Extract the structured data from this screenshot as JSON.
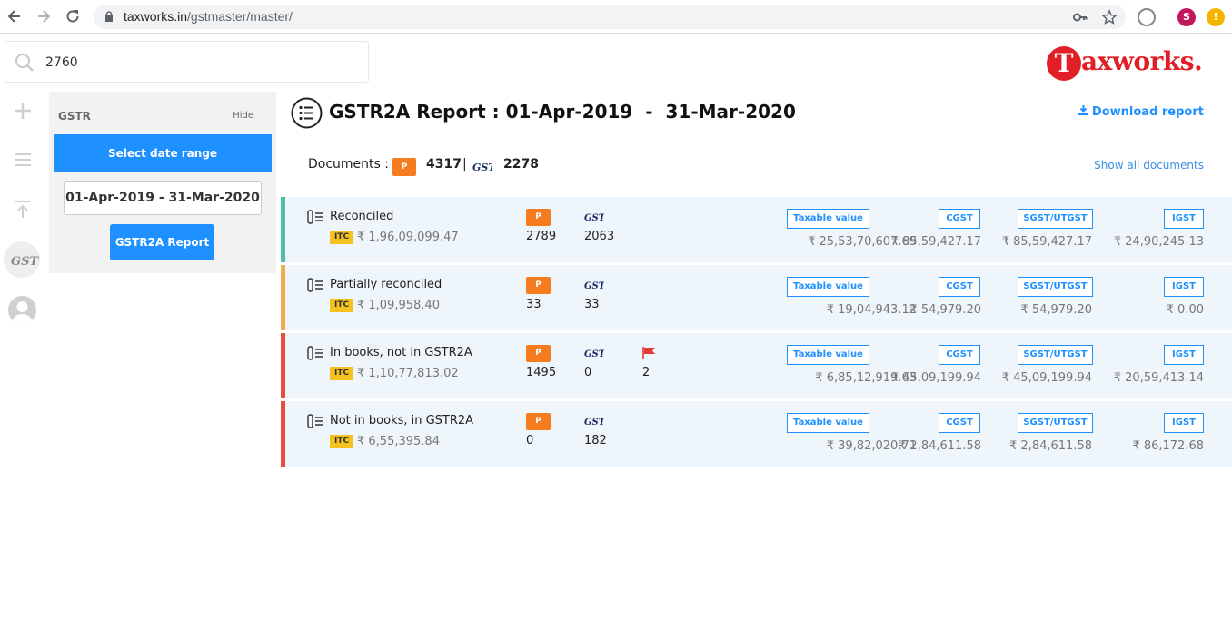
{
  "browser": {
    "url_host": "taxworks.in",
    "url_path": "/gstmaster/master/",
    "profile_initial": "S",
    "alert_symbol": "!"
  },
  "search": {
    "value": "2760"
  },
  "logo": {
    "first_letter": "T",
    "rest": "axworks."
  },
  "sidebar": {
    "title": "GSTR",
    "hide_label": "Hide",
    "select_label": "Select date range",
    "date_range": "01-Apr-2019 - 31-Mar-2020",
    "report_button": "GSTR2A Report"
  },
  "main": {
    "title": "GSTR2A Report : 01-Apr-2019  -  31-Mar-2020",
    "download_label": "Download report",
    "show_all": "Show all documents",
    "documents": {
      "label": "Documents :",
      "p_badge": "P",
      "p_count": "4317",
      "separator": "|",
      "gst_count": "2278"
    }
  },
  "columns": {
    "taxable": "Taxable value",
    "cgst": "CGST",
    "sgst": "SGST/UTGST",
    "igst": "IGST"
  },
  "rows": [
    {
      "label": "Reconciled",
      "itc": "ITC",
      "itc_value": "₹ 1,96,09,099.47",
      "p_badge": "P",
      "p_count": "2789",
      "gst_count": "2063",
      "flag_count": "",
      "taxable": "₹ 25,53,70,607.69",
      "cgst": "₹ 85,59,427.17",
      "sgst": "₹ 85,59,427.17",
      "igst": "₹ 24,90,245.13",
      "color": "#4cbfa6"
    },
    {
      "label": "Partially reconciled",
      "itc": "ITC",
      "itc_value": "₹ 1,09,958.40",
      "p_badge": "P",
      "p_count": "33",
      "gst_count": "33",
      "flag_count": "",
      "taxable": "₹ 19,04,943.12",
      "cgst": "₹ 54,979.20",
      "sgst": "₹ 54,979.20",
      "igst": "₹ 0.00",
      "color": "#f0ad4e"
    },
    {
      "label": "In books, not in GSTR2A",
      "itc": "ITC",
      "itc_value": "₹ 1,10,77,813.02",
      "p_badge": "P",
      "p_count": "1495",
      "gst_count": "0",
      "flag_count": "2",
      "taxable": "₹ 6,85,12,919.63",
      "cgst": "₹ 45,09,199.94",
      "sgst": "₹ 45,09,199.94",
      "igst": "₹ 20,59,413.14",
      "color": "#e84c3d"
    },
    {
      "label": "Not in books, in GSTR2A",
      "itc": "ITC",
      "itc_value": "₹ 6,55,395.84",
      "p_badge": "P",
      "p_count": "0",
      "gst_count": "182",
      "flag_count": "",
      "taxable": "₹ 39,82,020.71",
      "cgst": "₹ 2,84,611.58",
      "sgst": "₹ 2,84,611.58",
      "igst": "₹ 86,172.68",
      "color": "#e84c3d"
    }
  ]
}
